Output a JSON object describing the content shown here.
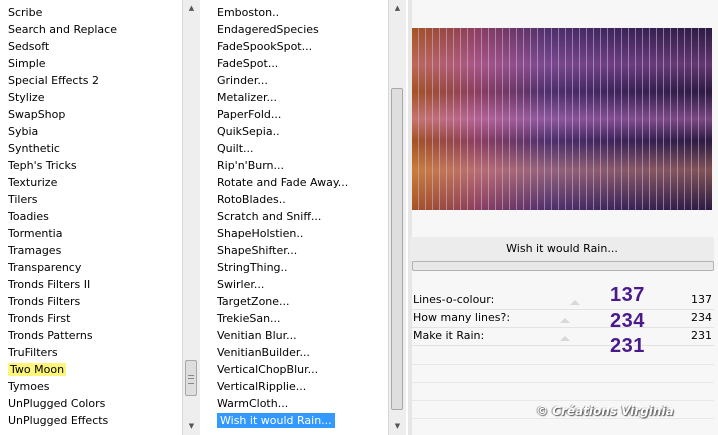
{
  "left_list": {
    "items": [
      "Scribe",
      "Search and Replace",
      "Sedsoft",
      "Simple",
      "Special Effects 2",
      "Stylize",
      "SwapShop",
      "Sybia",
      "Synthetic",
      "Teph's Tricks",
      "Texturize",
      "Tilers",
      "Toadies",
      "Tormentia",
      "Tramages",
      "Transparency",
      "Tronds Filters II",
      "Tronds Filters",
      "Tronds First",
      "Tronds Patterns",
      "TruFilters",
      "Two Moon",
      "Tymoes",
      "UnPlugged Colors",
      "UnPlugged Effects"
    ],
    "highlighted": "Two Moon"
  },
  "mid_list": {
    "items": [
      "Emboston..",
      "EndageredSpecies",
      "FadeSpookSpot...",
      "FadeSpot...",
      "Grinder...",
      "Metalizer...",
      "PaperFold...",
      "QuikSepia..",
      "Quilt...",
      "Rip'n'Burn...",
      "Rotate and Fade Away...",
      "RotoBlades..",
      "Scratch and Sniff...",
      "ShapeHolstien..",
      "ShapeShifter...",
      "StringThing..",
      "Swirler...",
      "TargetZone...",
      "TrekieSan...",
      "Venitian Blur...",
      "VenitianBuilder...",
      "VerticalChopBlur...",
      "VerticalRipplie...",
      "WarmCloth...",
      "Wish it would Rain..."
    ],
    "selected": "Wish it would Rain..."
  },
  "scroll_icons": {
    "up": "chevron-up-icon",
    "down": "chevron-down-icon"
  },
  "filter": {
    "title": "Wish it would Rain...",
    "params": [
      {
        "label": "Lines-o-colour:",
        "value": "137",
        "big": "137"
      },
      {
        "label": "How many lines?:",
        "value": "234",
        "big": "234"
      },
      {
        "label": "Make it Rain:",
        "value": "231",
        "big": "231"
      }
    ]
  },
  "watermark": "© Créations Virginia",
  "colors": {
    "highlight": "#fcf67a",
    "selection": "#3399ff",
    "annotation": "#4a1a8a"
  }
}
